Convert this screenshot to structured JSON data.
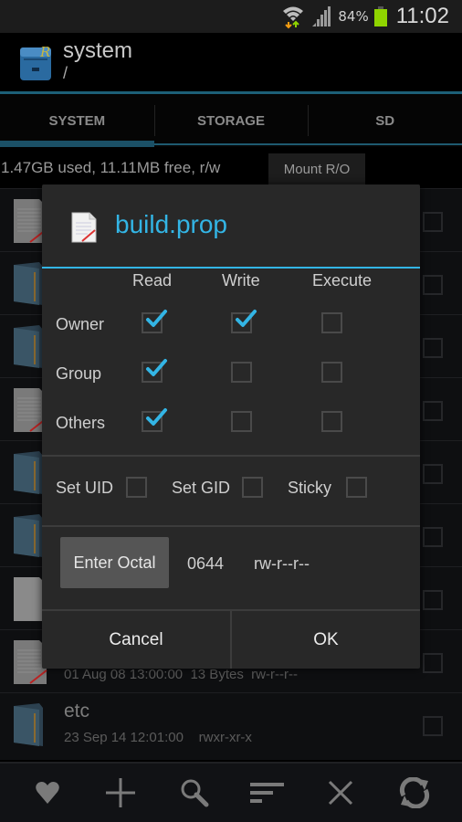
{
  "status_bar": {
    "battery_percent": "84%",
    "time": "11:02",
    "battery_color": "#8fd400"
  },
  "action_bar": {
    "title": "system",
    "subtitle": "/"
  },
  "tabs": [
    {
      "label": "SYSTEM",
      "active": true
    },
    {
      "label": "STORAGE",
      "active": false
    },
    {
      "label": "SD",
      "active": false
    }
  ],
  "info": {
    "usage_text": "1.47GB used, 11.11MB free, r/w",
    "mount_button": "Mount R/O"
  },
  "files": [
    {
      "type": "text-file",
      "name": "",
      "meta": ""
    },
    {
      "type": "folder",
      "name": "",
      "meta": ""
    },
    {
      "type": "folder",
      "name": "",
      "meta": ""
    },
    {
      "type": "text-file",
      "name": "",
      "meta": ""
    },
    {
      "type": "folder",
      "name": "",
      "meta": ""
    },
    {
      "type": "folder",
      "name": "",
      "meta": ""
    },
    {
      "type": "blank-file",
      "name": "",
      "meta": ""
    },
    {
      "type": "text-file",
      "name": "",
      "meta": "01 Aug 08 13:00:00  13 Bytes  rw-r--r--"
    },
    {
      "type": "folder",
      "name": "etc",
      "meta": "23 Sep 14 12:01:00    rwxr-xr-x"
    }
  ],
  "dialog": {
    "title": "build.prop",
    "accent_color": "#33b5e5",
    "columns": [
      "Read",
      "Write",
      "Execute"
    ],
    "rows": [
      {
        "label": "Owner",
        "read": true,
        "write": true,
        "execute": false
      },
      {
        "label": "Group",
        "read": true,
        "write": false,
        "execute": false
      },
      {
        "label": "Others",
        "read": true,
        "write": false,
        "execute": false
      }
    ],
    "special": [
      {
        "label": "Set UID",
        "checked": false
      },
      {
        "label": "Set GID",
        "checked": false
      },
      {
        "label": "Sticky",
        "checked": false
      }
    ],
    "octal_button": "Enter Octal",
    "octal_value": "0644",
    "permission_string": "rw-r--r--",
    "cancel_label": "Cancel",
    "ok_label": "OK"
  },
  "bottom_bar": {
    "icons": [
      "heart-icon",
      "plus-icon",
      "search-icon",
      "sort-icon",
      "close-icon",
      "refresh-icon"
    ]
  }
}
